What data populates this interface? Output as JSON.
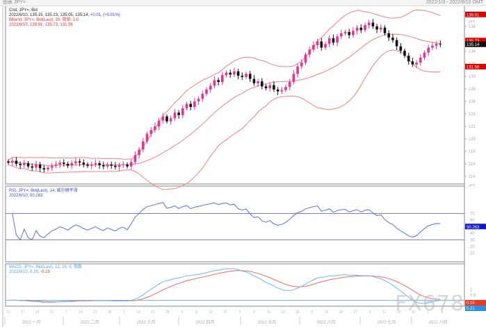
{
  "window": {
    "title": "图表 JPY=",
    "range": "2022/1/3 - 2022/8/10 GMT"
  },
  "legend": {
    "main_l1": "Cnd, JPY=, Bid",
    "main_l2a": "2022/8/10, 135.15, 135.23, 135.05, 135.14, ",
    "main_l2b": "+0.01, (+0.01%)",
    "bb_l1": "BBand, JPY=, Bid(Last), 20, 简单, 2.0",
    "bb_l2": "2022/8/10, 139.91, 135.73, 131.56",
    "rsi_l1": "RSI, JPY=, Bid(Last), 14, 威尔德平滑",
    "rsi_l2": "2022/8/10, 50.263",
    "macd_l1": "MACD, JPY=, Bid(Last), 12, 26, 9, 指数",
    "macd_l2a": "2022/8/10, 0.29, ",
    "macd_l2b": "-0.19"
  },
  "watermark": "FX678",
  "colors": {
    "up": "#e6338f",
    "down": "#111111",
    "band": "#f08080",
    "rsi": "#5b6ee1",
    "macd": "#6ab8ee",
    "signal": "#f26b5b"
  },
  "chart_data": {
    "type": "candlestick",
    "title": "JPY= daily",
    "closes": [
      116.2,
      116.5,
      116.0,
      115.8,
      116.1,
      115.6,
      115.4,
      115.9,
      115.3,
      115.1,
      115.4,
      115.7,
      115.9,
      116.2,
      116.0,
      115.7,
      116.1,
      116.4,
      116.2,
      115.9,
      115.7,
      115.9,
      116.1,
      115.8,
      115.6,
      115.9,
      115.7,
      115.5,
      115.8,
      115.9,
      115.6,
      116.3,
      117.4,
      118.3,
      119.6,
      120.8,
      121.4,
      122.0,
      122.9,
      123.6,
      122.8,
      123.3,
      124.2,
      123.8,
      124.9,
      125.6,
      125.1,
      126.0,
      126.4,
      127.2,
      127.9,
      128.5,
      129.4,
      129.1,
      130.2,
      130.6,
      130.3,
      130.8,
      130.1,
      129.9,
      130.4,
      129.6,
      128.9,
      129.2,
      128.4,
      128.1,
      128.6,
      127.9,
      127.6,
      127.8,
      128.3,
      129.1,
      130.4,
      131.6,
      132.2,
      133.5,
      134.3,
      135.0,
      135.6,
      134.6,
      135.2,
      136.1,
      135.4,
      136.4,
      136.9,
      137.1,
      136.6,
      137.3,
      137.8,
      137.4,
      138.2,
      138.6,
      138.0,
      137.5,
      137.8,
      136.9,
      136.2,
      135.8,
      134.8,
      134.1,
      133.3,
      132.4,
      131.9,
      132.2,
      133.0,
      133.8,
      134.6,
      134.9,
      135.2,
      135.14
    ],
    "price_ticks": [
      138,
      136,
      134,
      132,
      130,
      128,
      126,
      124,
      122,
      120,
      118,
      116,
      114
    ],
    "price_tags": [
      {
        "v": 139.91,
        "label": "139.91",
        "color": "#e00000"
      },
      {
        "v": 135.73,
        "label": "135.73",
        "color": "#e00000"
      },
      {
        "v": 135.14,
        "label": "135.14",
        "color": "#111111"
      },
      {
        "v": 131.56,
        "label": "131.56",
        "color": "#e00000"
      }
    ],
    "unit_label": "JPY",
    "rsi_ticks": [
      70,
      60,
      40,
      30,
      20,
      10
    ],
    "rsi_levels": [
      70,
      30
    ],
    "rsi_tag": "50.263",
    "macd_ticks": [
      1,
      0.5
    ],
    "macd_tags": [
      {
        "label": "0.15",
        "color": "#e83a20"
      },
      {
        "label": "0.21",
        "color": "#2d8ee0"
      }
    ],
    "months": [
      "2022 一月",
      "2022 二月",
      "2022 三月",
      "2022 四月",
      "2022 五月",
      "2022 六月",
      "2022 七月",
      "2022 八月"
    ],
    "days": [
      "10",
      "17",
      "24",
      "31",
      "7",
      "14",
      "21",
      "28",
      "7",
      "14",
      "21",
      "28",
      "4",
      "11",
      "18",
      "25",
      "2",
      "9",
      "16",
      "23",
      "30",
      "6",
      "13",
      "20",
      "27",
      "4",
      "11",
      "18",
      "25",
      "1",
      "8"
    ]
  }
}
